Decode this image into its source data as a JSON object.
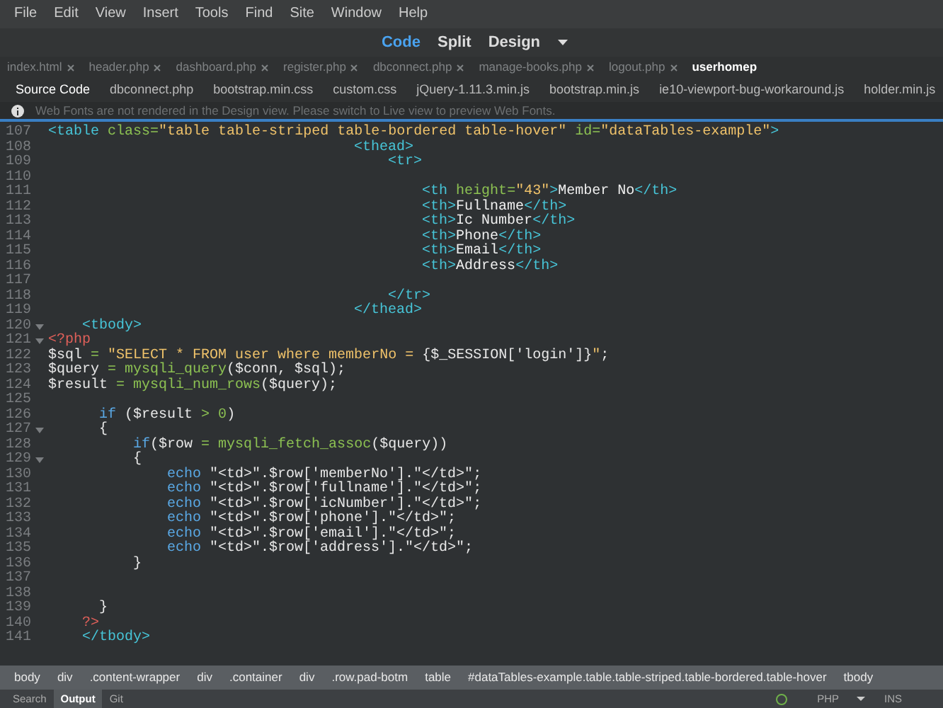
{
  "menu": [
    "File",
    "Edit",
    "View",
    "Insert",
    "Tools",
    "Find",
    "Site",
    "Window",
    "Help"
  ],
  "view_switch": [
    {
      "label": "Code",
      "selected": true
    },
    {
      "label": "Split",
      "selected": false
    },
    {
      "label": "Design",
      "selected": false
    }
  ],
  "document_tabs": [
    {
      "label": "index.html",
      "selected": false
    },
    {
      "label": "header.php",
      "selected": false
    },
    {
      "label": "dashboard.php",
      "selected": false
    },
    {
      "label": "register.php",
      "selected": false
    },
    {
      "label": "dbconnect.php",
      "selected": false
    },
    {
      "label": "manage-books.php",
      "selected": false
    },
    {
      "label": "logout.php",
      "selected": false
    },
    {
      "label": "userhomep",
      "selected": true
    }
  ],
  "related_files": [
    {
      "label": "Source Code",
      "selected": true
    },
    {
      "label": "dbconnect.php",
      "selected": false
    },
    {
      "label": "bootstrap.min.css",
      "selected": false
    },
    {
      "label": "custom.css",
      "selected": false
    },
    {
      "label": "jQuery-1.11.3.min.js",
      "selected": false
    },
    {
      "label": "bootstrap.min.js",
      "selected": false
    },
    {
      "label": "ie10-viewport-bug-workaround.js",
      "selected": false
    },
    {
      "label": "holder.min.js",
      "selected": false
    }
  ],
  "info_bar": {
    "message": "Web Fonts are not rendered in the Design view. Please switch to Live view to preview Web Fonts."
  },
  "code_lines": [
    {
      "number": "107",
      "fold": false,
      "tokens": [
        {
          "kind": "tag",
          "text": "<table "
        },
        {
          "kind": "attr",
          "text": "class"
        },
        {
          "kind": "op",
          "text": "="
        },
        {
          "kind": "string",
          "text": "\"table table-striped table-bordered table-hover\""
        },
        {
          "kind": "attr",
          "text": " id"
        },
        {
          "kind": "op",
          "text": "="
        },
        {
          "kind": "string",
          "text": "\"dataTables-example\""
        },
        {
          "kind": "tag",
          "text": ">"
        }
      ]
    },
    {
      "number": "108",
      "fold": false,
      "tokens": [
        {
          "kind": "tag",
          "text": "                                    <thead>"
        }
      ]
    },
    {
      "number": "109",
      "fold": false,
      "tokens": [
        {
          "kind": "tag",
          "text": "                                        <tr>"
        }
      ]
    },
    {
      "number": "110",
      "fold": false
    },
    {
      "number": "111",
      "fold": false,
      "tokens": [
        {
          "kind": "tag",
          "text": "                                            <th "
        },
        {
          "kind": "attr",
          "text": "height"
        },
        {
          "kind": "op",
          "text": "="
        },
        {
          "kind": "string",
          "text": "\"43\""
        },
        {
          "kind": "tag",
          "text": ">"
        },
        {
          "kind": "text",
          "text": "Member No"
        },
        {
          "kind": "tag",
          "text": "</th>"
        }
      ]
    },
    {
      "number": "112",
      "fold": false,
      "tokens": [
        {
          "kind": "tag",
          "text": "                                            <th>"
        },
        {
          "kind": "text",
          "text": "Fullname"
        },
        {
          "kind": "tag",
          "text": "</th>"
        }
      ]
    },
    {
      "number": "113",
      "fold": false,
      "tokens": [
        {
          "kind": "tag",
          "text": "                                            <th>"
        },
        {
          "kind": "text",
          "text": "Ic Number"
        },
        {
          "kind": "tag",
          "text": "</th>"
        }
      ]
    },
    {
      "number": "114",
      "fold": false,
      "tokens": [
        {
          "kind": "tag",
          "text": "                                            <th>"
        },
        {
          "kind": "text",
          "text": "Phone"
        },
        {
          "kind": "tag",
          "text": "</th>"
        }
      ]
    },
    {
      "number": "115",
      "fold": false,
      "tokens": [
        {
          "kind": "tag",
          "text": "                                            <th>"
        },
        {
          "kind": "text",
          "text": "Email"
        },
        {
          "kind": "tag",
          "text": "</th>"
        }
      ]
    },
    {
      "number": "116",
      "fold": false,
      "tokens": [
        {
          "kind": "tag",
          "text": "                                            <th>"
        },
        {
          "kind": "text",
          "text": "Address"
        },
        {
          "kind": "tag",
          "text": "</th>"
        }
      ]
    },
    {
      "number": "117",
      "fold": false
    },
    {
      "number": "118",
      "fold": false,
      "tokens": [
        {
          "kind": "tag",
          "text": "                                        </tr>"
        }
      ]
    },
    {
      "number": "119",
      "fold": false,
      "tokens": [
        {
          "kind": "tag",
          "text": "                                    </thead>"
        }
      ]
    },
    {
      "number": "120",
      "fold": true,
      "tokens": [
        {
          "kind": "tag",
          "text": "    <tbody>"
        }
      ]
    },
    {
      "number": "121",
      "fold": true,
      "tokens": [
        {
          "kind": "php",
          "text": "<?php"
        }
      ]
    },
    {
      "number": "122",
      "fold": false,
      "tokens": [
        {
          "kind": "var",
          "text": "$sql "
        },
        {
          "kind": "op",
          "text": "="
        },
        {
          "kind": "string",
          "text": " \"SELECT * FROM user where memberNo = "
        },
        {
          "kind": "var",
          "text": "{$_SESSION['login']}"
        },
        {
          "kind": "string",
          "text": "\""
        },
        {
          "kind": "var",
          "text": ";"
        }
      ]
    },
    {
      "number": "123",
      "fold": false,
      "tokens": [
        {
          "kind": "var",
          "text": "$query "
        },
        {
          "kind": "op",
          "text": "="
        },
        {
          "kind": "func",
          "text": " mysqli_query"
        },
        {
          "kind": "var",
          "text": "($conn, $sql);"
        }
      ]
    },
    {
      "number": "124",
      "fold": false,
      "tokens": [
        {
          "kind": "var",
          "text": "$result "
        },
        {
          "kind": "op",
          "text": "="
        },
        {
          "kind": "func",
          "text": " mysqli_num_rows"
        },
        {
          "kind": "var",
          "text": "($query);"
        }
      ]
    },
    {
      "number": "125",
      "fold": false
    },
    {
      "number": "126",
      "fold": false,
      "tokens": [
        {
          "kind": "keyword",
          "text": "      if"
        },
        {
          "kind": "var",
          "text": " ($result "
        },
        {
          "kind": "op",
          "text": ">"
        },
        {
          "kind": "number",
          "text": " 0"
        },
        {
          "kind": "var",
          "text": ")"
        }
      ]
    },
    {
      "number": "127",
      "fold": true,
      "tokens": [
        {
          "kind": "var",
          "text": "      {"
        }
      ]
    },
    {
      "number": "128",
      "fold": false,
      "tokens": [
        {
          "kind": "keyword",
          "text": "          if"
        },
        {
          "kind": "var",
          "text": "($row "
        },
        {
          "kind": "op",
          "text": "="
        },
        {
          "kind": "func",
          "text": " mysqli_fetch_assoc"
        },
        {
          "kind": "var",
          "text": "($query))"
        }
      ]
    },
    {
      "number": "129",
      "fold": true,
      "tokens": [
        {
          "kind": "var",
          "text": "          {"
        }
      ]
    },
    {
      "number": "130",
      "fold": false,
      "tokens": [
        {
          "kind": "keyword",
          "text": "              echo"
        },
        {
          "kind": "var",
          "text": " \"<td>\".$row['memberNo'].\"</td>\";"
        }
      ]
    },
    {
      "number": "131",
      "fold": false,
      "tokens": [
        {
          "kind": "keyword",
          "text": "              echo"
        },
        {
          "kind": "var",
          "text": " \"<td>\".$row['fullname'].\"</td>\";"
        }
      ]
    },
    {
      "number": "132",
      "fold": false,
      "tokens": [
        {
          "kind": "keyword",
          "text": "              echo"
        },
        {
          "kind": "var",
          "text": " \"<td>\".$row['icNumber'].\"</td>\";"
        }
      ]
    },
    {
      "number": "133",
      "fold": false,
      "tokens": [
        {
          "kind": "keyword",
          "text": "              echo"
        },
        {
          "kind": "var",
          "text": " \"<td>\".$row['phone'].\"</td>\";"
        }
      ]
    },
    {
      "number": "134",
      "fold": false,
      "tokens": [
        {
          "kind": "keyword",
          "text": "              echo"
        },
        {
          "kind": "var",
          "text": " \"<td>\".$row['email'].\"</td>\";"
        }
      ]
    },
    {
      "number": "135",
      "fold": false,
      "tokens": [
        {
          "kind": "keyword",
          "text": "              echo"
        },
        {
          "kind": "var",
          "text": " \"<td>\".$row['address'].\"</td>\";"
        }
      ]
    },
    {
      "number": "136",
      "fold": false,
      "tokens": [
        {
          "kind": "var",
          "text": "          }"
        }
      ]
    },
    {
      "number": "137",
      "fold": false
    },
    {
      "number": "138",
      "fold": false
    },
    {
      "number": "139",
      "fold": false,
      "tokens": [
        {
          "kind": "var",
          "text": "      }"
        }
      ]
    },
    {
      "number": "140",
      "fold": false,
      "tokens": [
        {
          "kind": "php",
          "text": "    ?>"
        }
      ]
    },
    {
      "number": "141",
      "fold": false,
      "tokens": [
        {
          "kind": "tag",
          "text": "    </tbody>"
        }
      ]
    }
  ],
  "tag_selector": [
    "body",
    "div",
    ".content-wrapper",
    "div",
    ".container",
    "div",
    ".row.pad-botm",
    "table",
    "#dataTables-example.table.table-striped.table-bordered.table-hover",
    "tbody"
  ],
  "panel_tabs": [
    {
      "label": "Search",
      "selected": false
    },
    {
      "label": "Output",
      "selected": true
    },
    {
      "label": "Git",
      "selected": false
    }
  ],
  "status_bar": {
    "language": "PHP",
    "mode": "INS"
  }
}
